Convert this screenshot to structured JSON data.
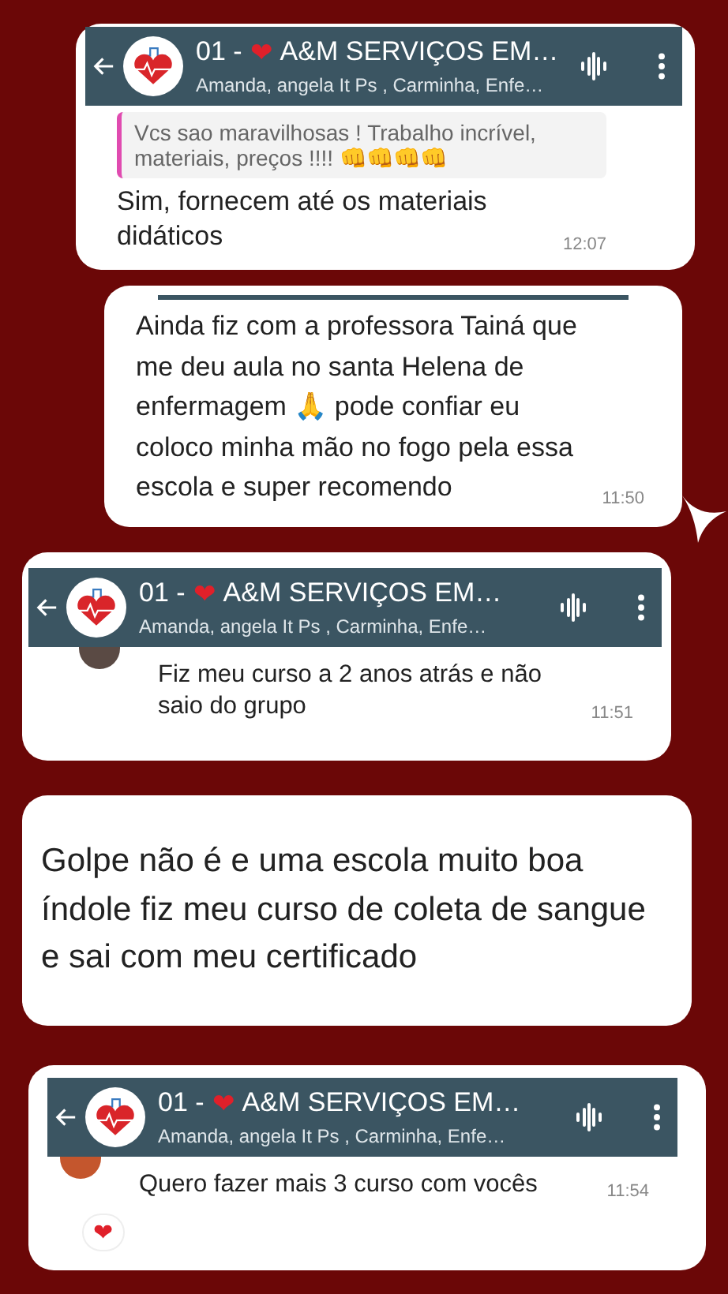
{
  "cards": [
    {
      "kind": "chat",
      "header": {
        "title_prefix": "01 -",
        "title_icon": "❤",
        "title_rest": "A&M SERVIÇOS EM…",
        "subtitle": "Amanda, angela It Ps , Carminha, Enfe…"
      },
      "quote": "Vcs sao maravilhosas ! Trabalho incrível, materiais, preços !!!! 👊👊👊👊",
      "message": "Sim, fornecem até os materiais didáticos",
      "time": "12:07"
    },
    {
      "kind": "bubble",
      "message": "Ainda fiz com a professora Tainá que me deu aula no santa Helena de enfermagem 🙏 pode confiar eu coloco minha mão no fogo pela essa escola e super recomendo",
      "time": "11:50"
    },
    {
      "kind": "chat",
      "header": {
        "title_prefix": "01 -",
        "title_icon": "❤",
        "title_rest": "A&M SERVIÇOS EM…",
        "subtitle": "Amanda, angela It Ps , Carminha, Enfe…"
      },
      "color": "#5a4a44",
      "message": "Fiz meu curso a 2 anos atrás e não saio do grupo",
      "time": "11:51"
    },
    {
      "kind": "note",
      "message": "Golpe não é  e uma escola muito boa índole fiz meu curso de coleta de sangue e sai com meu certificado"
    },
    {
      "kind": "chat",
      "header": {
        "title_prefix": "01 -",
        "title_icon": "❤",
        "title_rest": "A&M SERVIÇOS EM…",
        "subtitle": "Amanda, angela It Ps , Carminha, Enfe…"
      },
      "color": "#c4562d",
      "message": "Quero fazer mais 3 curso com vocês",
      "time": "11:54",
      "reaction": "❤"
    }
  ]
}
